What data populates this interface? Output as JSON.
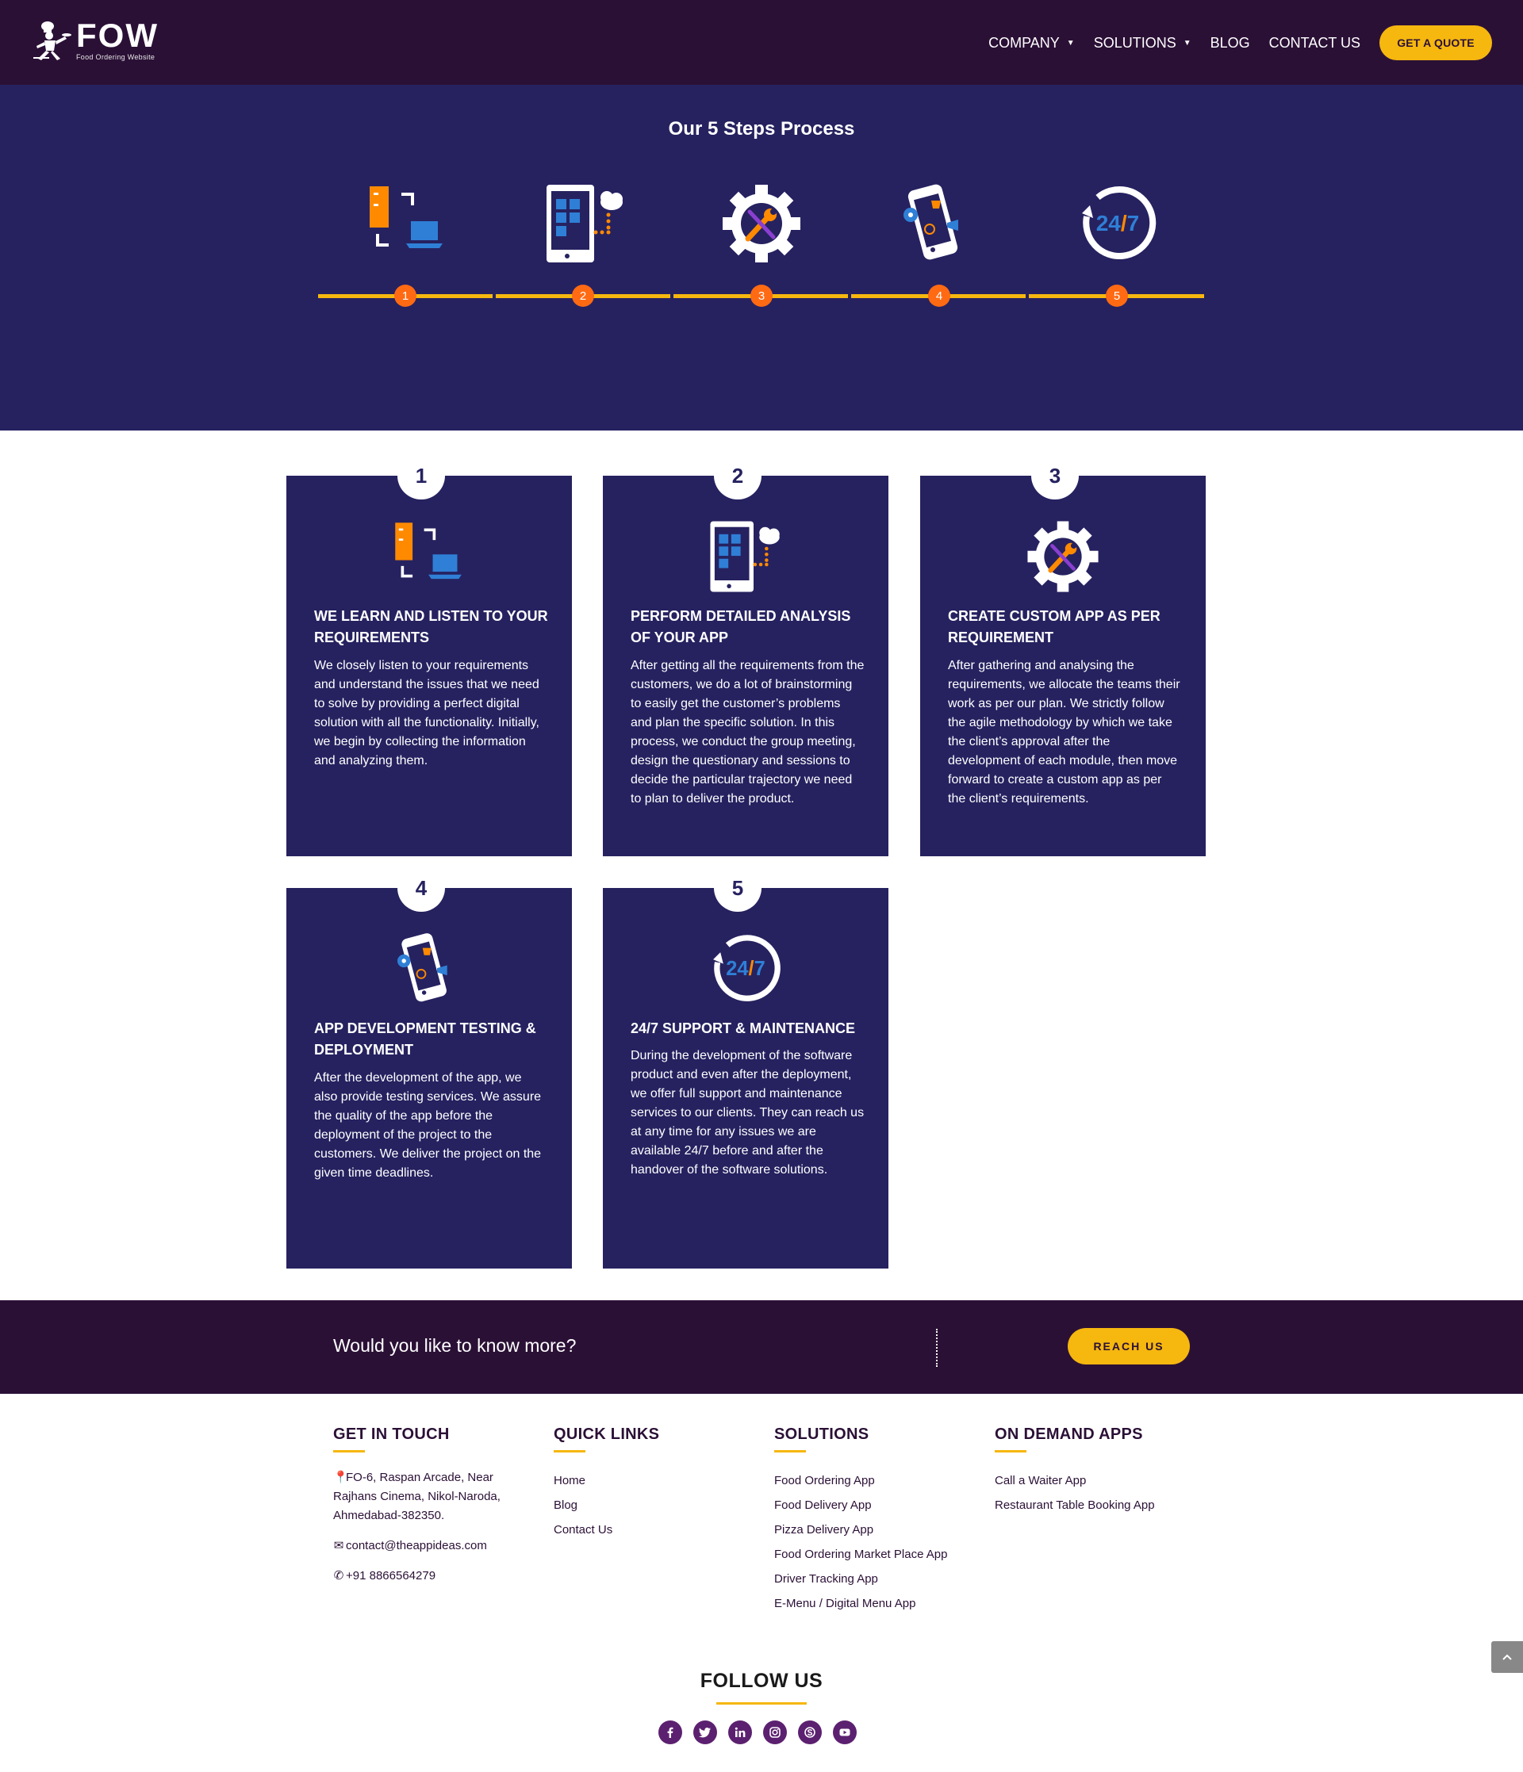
{
  "header": {
    "logo_title": "FOW",
    "logo_sub": "Food Ordering Website",
    "nav": [
      {
        "label": "COMPANY",
        "dropdown": true
      },
      {
        "label": "SOLUTIONS",
        "dropdown": true
      },
      {
        "label": "BLOG",
        "dropdown": false
      },
      {
        "label": "CONTACT US",
        "dropdown": false
      }
    ],
    "cta_label": "GET A QUOTE"
  },
  "steps": {
    "title": "Our 5 Steps Process",
    "numbers": [
      "1",
      "2",
      "3",
      "4",
      "5"
    ],
    "icons": [
      "server-laptop-icon",
      "tablet-cloud-icon",
      "gear-wrench-icon",
      "phone-cart-icon",
      "support-24-7-icon"
    ]
  },
  "cards": [
    {
      "num": "1",
      "icon": "server-laptop-icon",
      "title": "WE LEARN AND LISTEN TO YOUR REQUIREMENTS",
      "text": "We closely listen to your requirements and understand the issues that we need to solve by providing a perfect digital solution with all the functionality. Initially, we begin by collecting the information and analyzing them."
    },
    {
      "num": "2",
      "icon": "tablet-cloud-icon",
      "title": "PERFORM DETAILED ANALYSIS OF YOUR APP",
      "text": "After getting all the requirements from the customers, we do a lot of brainstorming to easily get the customer’s problems and plan the specific solution. In this process, we conduct the group meeting, design the questionary and sessions to decide the particular trajectory we need to plan to deliver the product."
    },
    {
      "num": "3",
      "icon": "gear-wrench-icon",
      "title": "CREATE CUSTOM APP AS PER REQUIREMENT",
      "text": "After gathering and analysing the requirements, we allocate the teams their work as per our plan. We strictly follow the agile methodology by which we take the client’s approval after the development of each module, then move forward to create a custom app as per the client’s requirements."
    },
    {
      "num": "4",
      "icon": "phone-cart-icon",
      "title": "APP DEVELOPMENT TESTING & DEPLOYMENT",
      "text": "After the development of the app, we also provide testing services. We assure the quality of the app before the deployment of the project to the customers. We deliver the project on the given time deadlines."
    },
    {
      "num": "5",
      "icon": "support-24-7-icon",
      "title": "24/7 SUPPORT & MAINTENANCE",
      "text": "During the development of the software product and even after the deployment, we offer full support and maintenance services to our clients. They can reach us at any time for any issues we are available 24/7 before and after the handover of the software solutions."
    }
  ],
  "cta": {
    "text": "Would you like to know more?",
    "button": "REACH US"
  },
  "footer": {
    "get_in_touch": {
      "heading": "GET IN TOUCH",
      "address": "FO-6, Raspan Arcade, Near Rajhans Cinema, Nikol-Naroda, Ahmedabad-382350.",
      "email": "contact@theappideas.com",
      "phone": "+91 8866564279"
    },
    "quick_links": {
      "heading": "QUICK LINKS",
      "items": [
        "Home",
        "Blog",
        "Contact Us"
      ]
    },
    "solutions": {
      "heading": "SOLUTIONS",
      "items": [
        "Food Ordering App",
        "Food Delivery App",
        "Pizza Delivery App",
        "Food Ordering Market Place App",
        "Driver Tracking App",
        "E-Menu / Digital Menu App"
      ]
    },
    "on_demand": {
      "heading": "ON DEMAND APPS",
      "items": [
        "Call a Waiter App",
        "Restaurant Table Booking App"
      ]
    },
    "follow": {
      "heading": "FOLLOW US",
      "socials": [
        "facebook-icon",
        "twitter-icon",
        "linkedin-icon",
        "instagram-icon",
        "skype-icon",
        "youtube-icon"
      ]
    }
  },
  "colors": {
    "header_bg": "#2b1036",
    "band_bg": "#262260",
    "accent_yellow": "#f6b70f",
    "accent_orange": "#ff6a13",
    "accent_blue": "#2f7fd6"
  }
}
